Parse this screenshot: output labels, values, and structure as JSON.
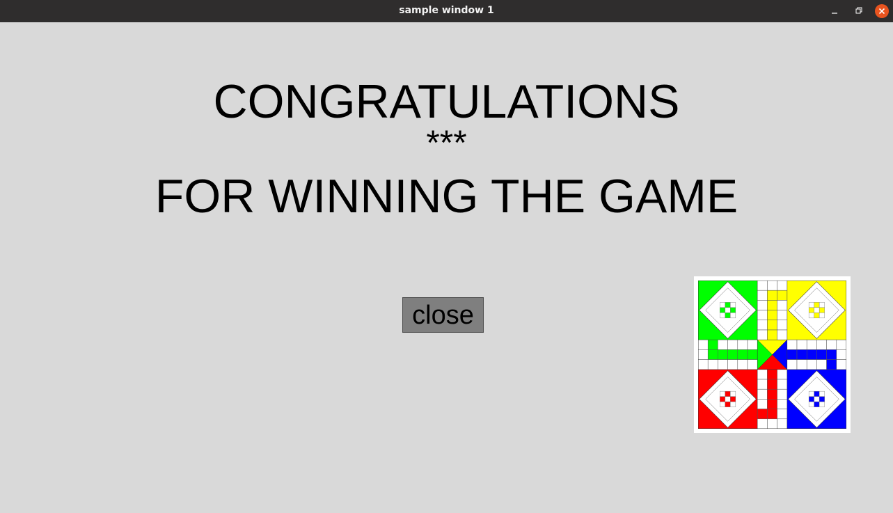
{
  "window": {
    "title": "sample window 1",
    "controls": {
      "minimize": "minimize-icon",
      "maximize": "maximize-icon",
      "close": "close-icon",
      "close_color": "#e9541f"
    }
  },
  "message": {
    "line1": "CONGRATULATIONS",
    "line2": "***",
    "line3": "FOR WINNING THE GAME"
  },
  "close_button": {
    "label": "close",
    "background": "#7f7f7f"
  },
  "board": {
    "icon": "ludo-board-image",
    "colors": {
      "green": "#00ff00",
      "yellow": "#ffff00",
      "red": "#ff0000",
      "blue": "#0000ff",
      "cell": "#ffffff"
    }
  }
}
